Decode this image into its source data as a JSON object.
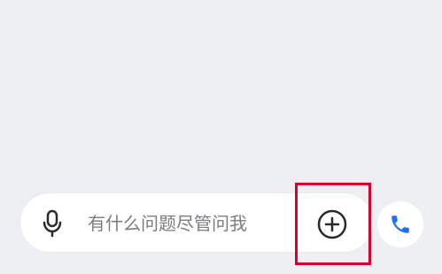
{
  "input": {
    "placeholder": "有什么问题尽管问我"
  },
  "icons": {
    "mic": "microphone-icon",
    "plus": "plus-icon",
    "phone": "phone-icon"
  },
  "colors": {
    "background": "#eeeff3",
    "input_background": "#ffffff",
    "placeholder": "#7a7c80",
    "icon_dark": "#2a2a2a",
    "phone_blue": "#1f6fff",
    "highlight_red": "#d7002f"
  }
}
